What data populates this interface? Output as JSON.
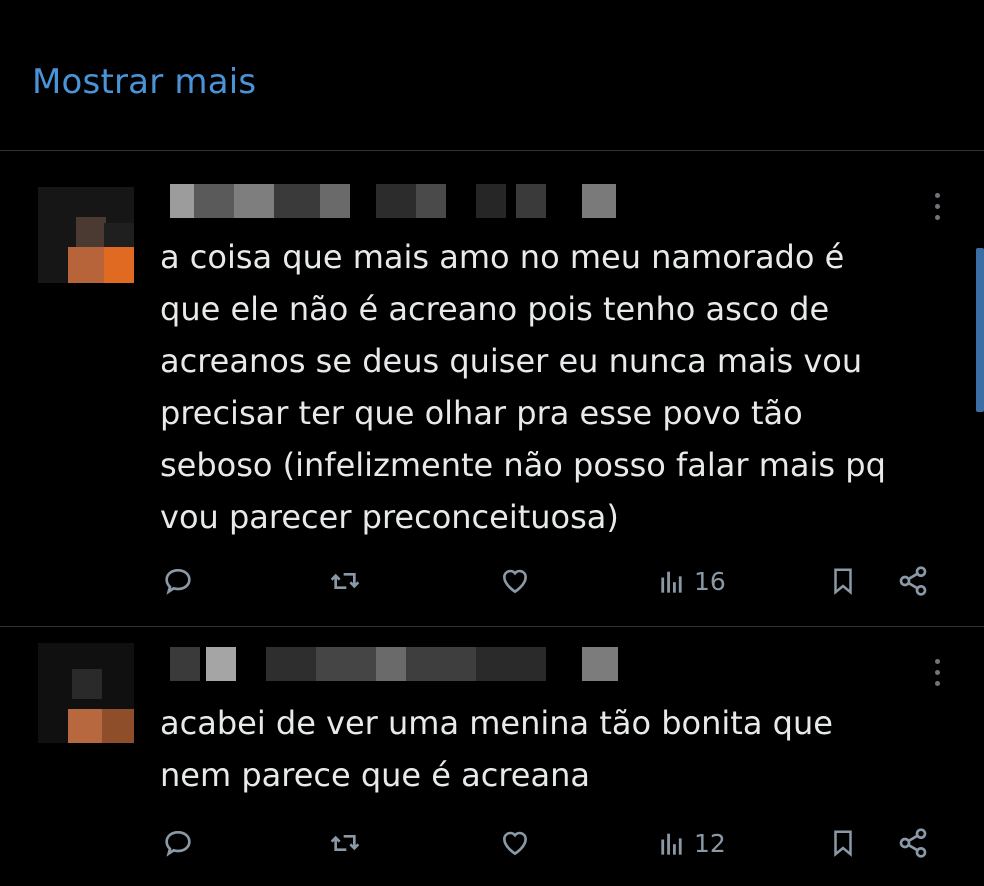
{
  "header": {
    "show_more_label": "Mostrar mais"
  },
  "posts": [
    {
      "text": "a coisa que mais amo no meu namorado é\nque ele não é acreano pois tenho asco de\nacreanos se deus quiser eu nunca mais vou\nprecisar ter que olhar pra esse povo tão\nseboso (infelizmente não posso falar mais pq\nvou parecer preconceituosa)",
      "views": "16"
    },
    {
      "text": "acabei de ver uma menina tão bonita que\nnem parece que é acreana",
      "views": "12"
    }
  ],
  "icons": [
    "reply-icon",
    "repost-icon",
    "like-icon",
    "views-icon",
    "bookmark-icon",
    "share-icon",
    "more-icon"
  ],
  "colors": {
    "background": "#000000",
    "link": "#4a93d6",
    "text": "#e7e9ea",
    "muted": "#8b98a5",
    "divider": "#2f3336"
  }
}
